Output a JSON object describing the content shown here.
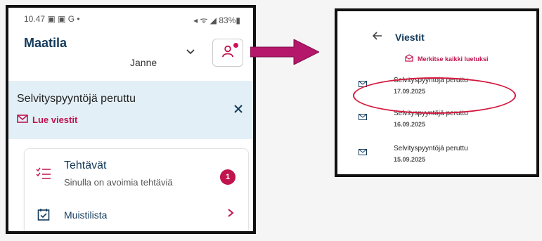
{
  "phone": {
    "status": {
      "time": "10.47",
      "left_icons": "▣ ▣ G •",
      "right": "◂ ᯤ ◢ 83%▮"
    },
    "app_title": "Maatila",
    "user_name": "Janne",
    "notice": {
      "title": "Selvityspyyntöjä peruttu",
      "link": "Lue viestit"
    },
    "tasks": {
      "title": "Tehtävät",
      "subtitle": "Sinulla on avoimia tehtäviä",
      "badge": "1"
    },
    "memo": {
      "title": "Muistilista"
    }
  },
  "panel": {
    "title": "Viestit",
    "mark_all": "Merkitse kaikki luetuksi",
    "messages": [
      {
        "title": "Selvityspyyntöjä peruttu",
        "date": "17.09.2025"
      },
      {
        "title": "Selvityspyyntöjä peruttu",
        "date": "16.09.2025"
      },
      {
        "title": "Selvityspyyntöjä peruttu",
        "date": "15.09.2025"
      }
    ]
  },
  "colors": {
    "accent": "#c0144f",
    "navy": "#133a5b",
    "notice_bg": "#e3eff6",
    "arrow": "#b5176b",
    "highlight": "#d4183d"
  }
}
